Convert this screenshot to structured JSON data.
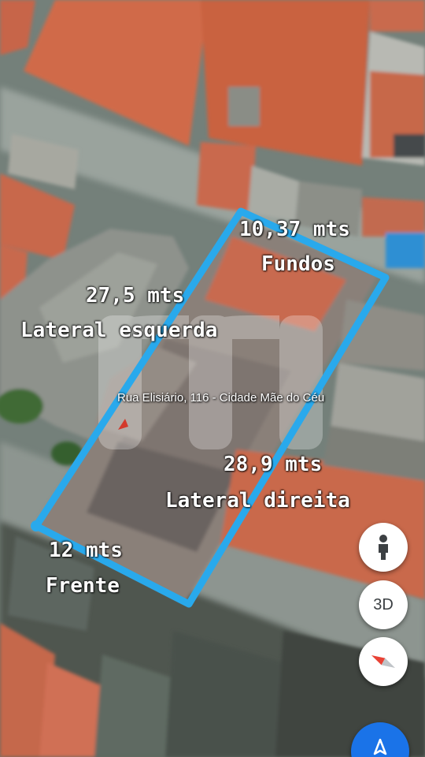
{
  "map": {
    "address_label": "Rua Elisiário, 116 - Cidade Mãe do Céu",
    "outline_color": "#29a9ec",
    "watermark_text": "m"
  },
  "measurements": {
    "back": {
      "length": "10,37 mts",
      "side": "Fundos"
    },
    "left": {
      "length": "27,5 mts",
      "side": "Lateral esquerda"
    },
    "right": {
      "length": "28,9 mts",
      "side": "Lateral direita"
    },
    "front": {
      "length": "12 mts",
      "side": "Frente"
    }
  },
  "controls": {
    "street_view_icon": "pegman-icon",
    "three_d_label": "3D",
    "compass_icon": "compass-icon",
    "navigate_icon": "navigation-arrow-icon"
  }
}
